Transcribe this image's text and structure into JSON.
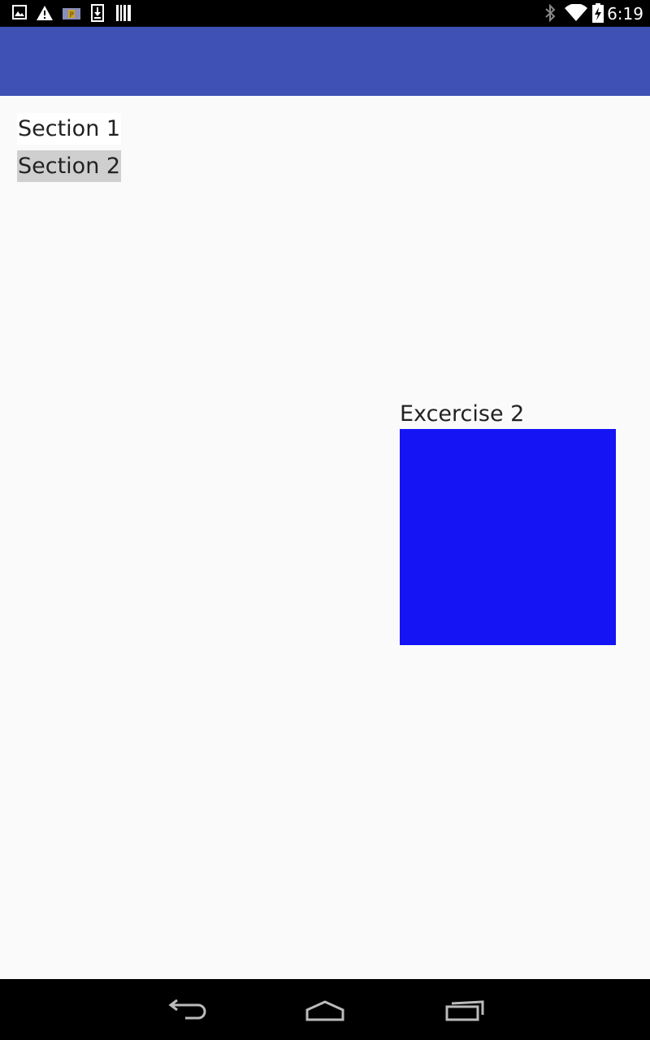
{
  "status_bar": {
    "time": "6:19",
    "left_icons": [
      "image-icon",
      "warning-icon",
      "parking-icon",
      "download-icon",
      "barcode-icon"
    ],
    "right_icons": [
      "bluetooth-icon",
      "wifi-icon",
      "battery-charging-icon"
    ]
  },
  "app_bar": {
    "color": "#3f51b5"
  },
  "sections": [
    {
      "label": "Section 1"
    },
    {
      "label": "Section 2",
      "selected": true
    }
  ],
  "exercise": {
    "label": "Excercise 2",
    "box_color": "#1414f5"
  },
  "nav_bar": {
    "buttons": [
      "back-icon",
      "home-icon",
      "recents-icon"
    ]
  }
}
